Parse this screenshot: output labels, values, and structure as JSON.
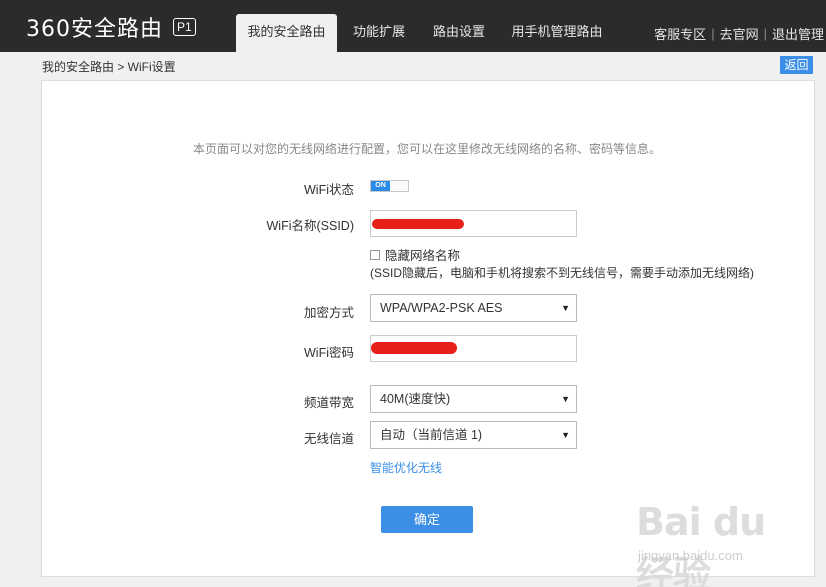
{
  "header": {
    "logo_text": "360安全路由",
    "logo_badge": "P1",
    "tabs": [
      {
        "label": "我的安全路由",
        "active": true
      },
      {
        "label": "功能扩展",
        "active": false
      },
      {
        "label": "路由设置",
        "active": false
      },
      {
        "label": "用手机管理路由",
        "active": false
      }
    ],
    "links": {
      "service": "客服专区",
      "official": "去官网",
      "logout": "退出管理"
    }
  },
  "breadcrumb": "我的安全路由 > WiFi设置",
  "back_label": "返回",
  "intro": "本页面可以对您的无线网络进行配置，您可以在这里修改无线网络的名称、密码等信息。",
  "form": {
    "wifi_status_label": "WiFi状态",
    "wifi_status_value": "ON",
    "ssid_label": "WiFi名称(SSID)",
    "ssid_value": "",
    "hide_label": "隐藏网络名称",
    "hide_note": "(SSID隐藏后，电脑和手机将搜索不到无线信号，需要手动添加无线网络)",
    "encryption_label": "加密方式",
    "encryption_value": "WPA/WPA2-PSK AES",
    "password_label": "WiFi密码",
    "password_value": "",
    "bandwidth_label": "频道带宽",
    "bandwidth_value": "40M(速度快)",
    "channel_label": "无线信道",
    "channel_value": "自动（当前信道 1)",
    "smart_optimize": "智能优化无线",
    "confirm": "确定"
  },
  "watermark": {
    "main": "Bai du经验",
    "sub": "jingyan.baidu.com"
  },
  "colors": {
    "header_bg": "#2b2b2b",
    "accent": "#3c8fe6",
    "toggle_on": "#2a8ce6"
  }
}
